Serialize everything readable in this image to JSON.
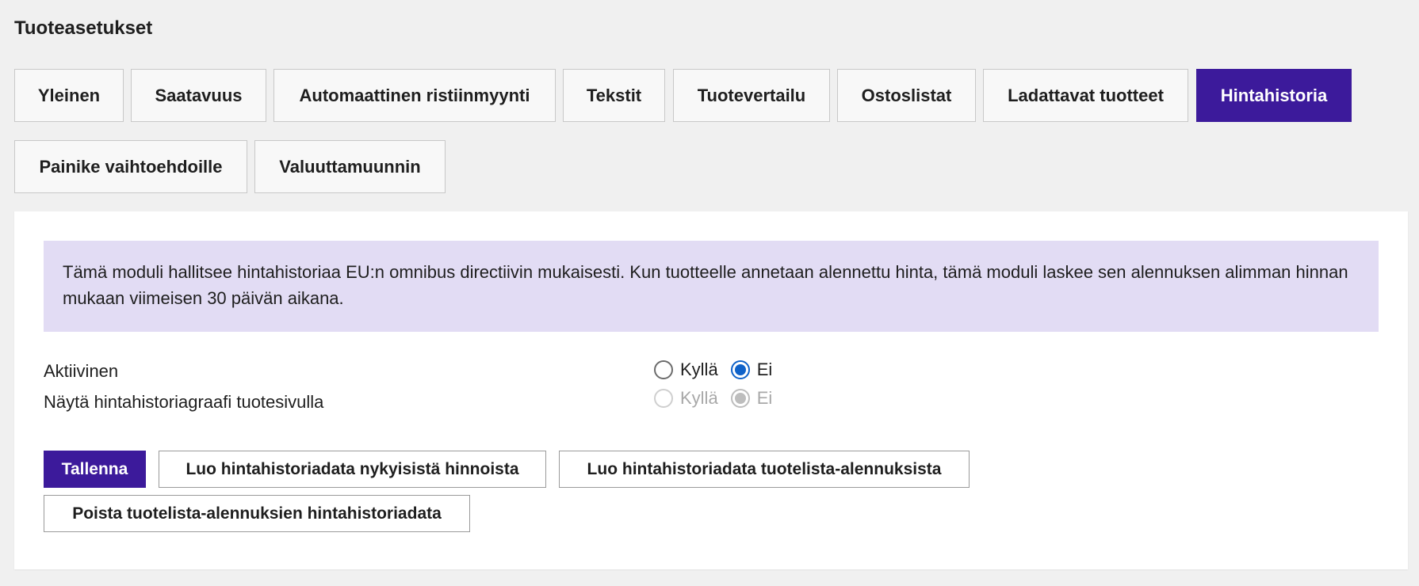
{
  "page": {
    "title": "Tuoteasetukset"
  },
  "tabs": [
    {
      "label": "Yleinen",
      "active": false
    },
    {
      "label": "Saatavuus",
      "active": false
    },
    {
      "label": "Automaattinen ristiinmyynti",
      "active": false
    },
    {
      "label": "Tekstit",
      "active": false
    },
    {
      "label": "Tuotevertailu",
      "active": false
    },
    {
      "label": "Ostoslistat",
      "active": false
    },
    {
      "label": "Ladattavat tuotteet",
      "active": false
    },
    {
      "label": "Hintahistoria",
      "active": true
    },
    {
      "label": "Painike vaihtoehdoille",
      "active": false
    },
    {
      "label": "Valuuttamuunnin",
      "active": false
    }
  ],
  "notice": {
    "text": "Tämä moduli hallitsee hintahistoriaa EU:n omnibus directiivin mukaisesti. Kun tuotteelle annetaan alennettu hinta, tämä moduli laskee sen alennuksen alimman hinnan mukaan viimeisen 30 päivän aikana."
  },
  "settings": {
    "active": {
      "label": "Aktiivinen",
      "yes_label": "Kyllä",
      "no_label": "Ei",
      "value": "Ei",
      "enabled": true
    },
    "show_graph": {
      "label": "Näytä hintahistoriagraafi tuotesivulla",
      "yes_label": "Kyllä",
      "no_label": "Ei",
      "value": "Ei",
      "enabled": false
    }
  },
  "buttons": {
    "save": "Tallenna",
    "create_from_current": "Luo hintahistoriadata nykyisistä hinnoista",
    "create_from_pricelist": "Luo hintahistoriadata tuotelista-alennuksista",
    "delete_pricelist": "Poista tuotelista-alennuksien hintahistoriadata"
  },
  "colors": {
    "accent": "#3c1a9b",
    "notice_bg": "#e2dcf4",
    "radio_checked": "#0f62c9",
    "page_bg": "#f0f0f0"
  }
}
